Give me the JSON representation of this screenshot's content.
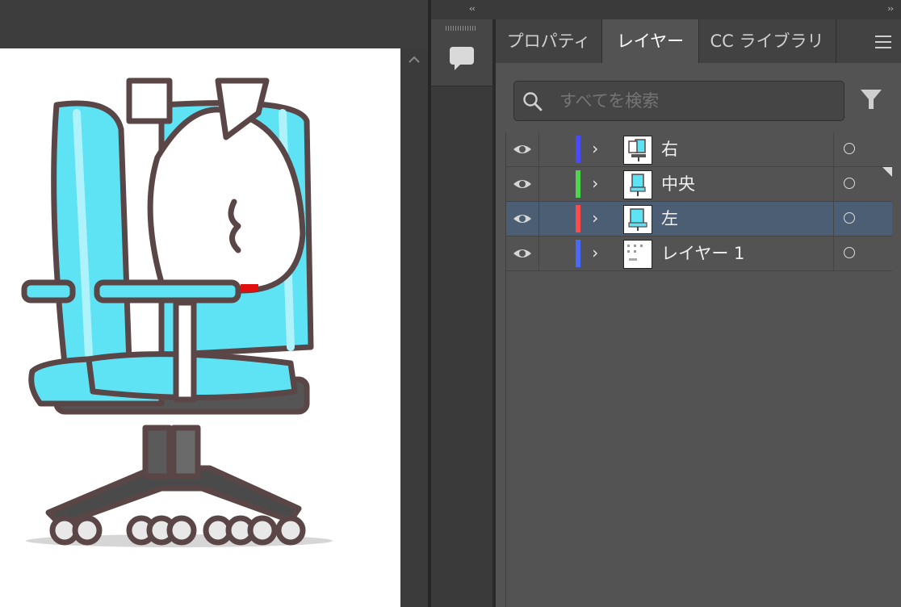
{
  "panel": {
    "tabs": [
      {
        "label": "プロパティ",
        "active": false
      },
      {
        "label": "レイヤー",
        "active": true
      },
      {
        "label": "CC ライブラリ",
        "active": false
      }
    ],
    "collapse_left": "‹‹",
    "collapse_right": "››"
  },
  "search": {
    "placeholder": "すべてを検索",
    "value": ""
  },
  "layers": [
    {
      "name": "右",
      "color": "#4a4aff",
      "selected": false
    },
    {
      "name": "中央",
      "color": "#4cd64c",
      "selected": false
    },
    {
      "name": "左",
      "color": "#ff4a4a",
      "selected": true
    },
    {
      "name": "レイヤー 1",
      "color": "#4a6aff",
      "selected": false
    }
  ],
  "colors": {
    "selection": "#4b5e74",
    "panel_bg": "#535353",
    "chair_blue": "#5ee3f5"
  },
  "icons": [
    "eye-icon",
    "chevron-right-icon",
    "target-circle-icon",
    "search-icon",
    "filter-icon",
    "panel-menu-icon",
    "comment-icon",
    "scroll-up-icon"
  ]
}
